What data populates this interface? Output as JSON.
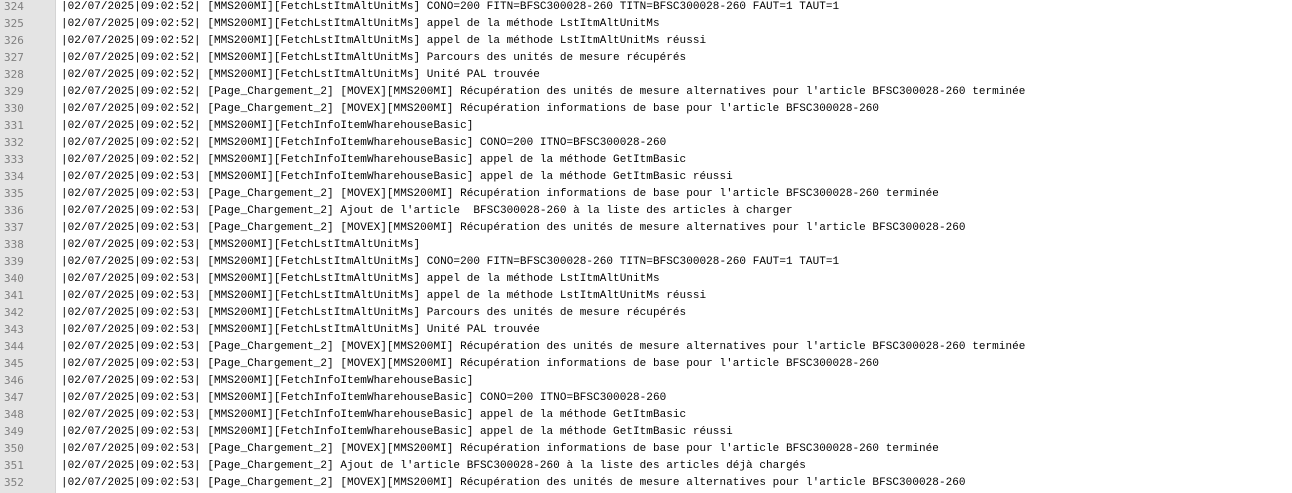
{
  "editor": {
    "lines": [
      {
        "num": "324",
        "text": "|02/07/2025|09:02:52| [MMS200MI][FetchLstItmAltUnitMs] CONO=200 FITN=BFSC300028-260 TITN=BFSC300028-260 FAUT=1 TAUT=1"
      },
      {
        "num": "325",
        "text": "|02/07/2025|09:02:52| [MMS200MI][FetchLstItmAltUnitMs] appel de la méthode LstItmAltUnitMs"
      },
      {
        "num": "326",
        "text": "|02/07/2025|09:02:52| [MMS200MI][FetchLstItmAltUnitMs] appel de la méthode LstItmAltUnitMs réussi"
      },
      {
        "num": "327",
        "text": "|02/07/2025|09:02:52| [MMS200MI][FetchLstItmAltUnitMs] Parcours des unités de mesure récupérés"
      },
      {
        "num": "328",
        "text": "|02/07/2025|09:02:52| [MMS200MI][FetchLstItmAltUnitMs] Unité PAL trouvée"
      },
      {
        "num": "329",
        "text": "|02/07/2025|09:02:52| [Page_Chargement_2] [MOVEX][MMS200MI] Récupération des unités de mesure alternatives pour l'article BFSC300028-260 terminée"
      },
      {
        "num": "330",
        "text": "|02/07/2025|09:02:52| [Page_Chargement_2] [MOVEX][MMS200MI] Récupération informations de base pour l'article BFSC300028-260"
      },
      {
        "num": "331",
        "text": "|02/07/2025|09:02:52| [MMS200MI][FetchInfoItemWharehouseBasic]"
      },
      {
        "num": "332",
        "text": "|02/07/2025|09:02:52| [MMS200MI][FetchInfoItemWharehouseBasic] CONO=200 ITNO=BFSC300028-260"
      },
      {
        "num": "333",
        "text": "|02/07/2025|09:02:52| [MMS200MI][FetchInfoItemWharehouseBasic] appel de la méthode GetItmBasic"
      },
      {
        "num": "334",
        "text": "|02/07/2025|09:02:53| [MMS200MI][FetchInfoItemWharehouseBasic] appel de la méthode GetItmBasic réussi"
      },
      {
        "num": "335",
        "text": "|02/07/2025|09:02:53| [Page_Chargement_2] [MOVEX][MMS200MI] Récupération informations de base pour l'article BFSC300028-260 terminée"
      },
      {
        "num": "336",
        "text": "|02/07/2025|09:02:53| [Page_Chargement_2] Ajout de l'article  BFSC300028-260 à la liste des articles à charger"
      },
      {
        "num": "337",
        "text": "|02/07/2025|09:02:53| [Page_Chargement_2] [MOVEX][MMS200MI] Récupération des unités de mesure alternatives pour l'article BFSC300028-260"
      },
      {
        "num": "338",
        "text": "|02/07/2025|09:02:53| [MMS200MI][FetchLstItmAltUnitMs]"
      },
      {
        "num": "339",
        "text": "|02/07/2025|09:02:53| [MMS200MI][FetchLstItmAltUnitMs] CONO=200 FITN=BFSC300028-260 TITN=BFSC300028-260 FAUT=1 TAUT=1"
      },
      {
        "num": "340",
        "text": "|02/07/2025|09:02:53| [MMS200MI][FetchLstItmAltUnitMs] appel de la méthode LstItmAltUnitMs"
      },
      {
        "num": "341",
        "text": "|02/07/2025|09:02:53| [MMS200MI][FetchLstItmAltUnitMs] appel de la méthode LstItmAltUnitMs réussi"
      },
      {
        "num": "342",
        "text": "|02/07/2025|09:02:53| [MMS200MI][FetchLstItmAltUnitMs] Parcours des unités de mesure récupérés"
      },
      {
        "num": "343",
        "text": "|02/07/2025|09:02:53| [MMS200MI][FetchLstItmAltUnitMs] Unité PAL trouvée"
      },
      {
        "num": "344",
        "text": "|02/07/2025|09:02:53| [Page_Chargement_2] [MOVEX][MMS200MI] Récupération des unités de mesure alternatives pour l'article BFSC300028-260 terminée"
      },
      {
        "num": "345",
        "text": "|02/07/2025|09:02:53| [Page_Chargement_2] [MOVEX][MMS200MI] Récupération informations de base pour l'article BFSC300028-260"
      },
      {
        "num": "346",
        "text": "|02/07/2025|09:02:53| [MMS200MI][FetchInfoItemWharehouseBasic]"
      },
      {
        "num": "347",
        "text": "|02/07/2025|09:02:53| [MMS200MI][FetchInfoItemWharehouseBasic] CONO=200 ITNO=BFSC300028-260"
      },
      {
        "num": "348",
        "text": "|02/07/2025|09:02:53| [MMS200MI][FetchInfoItemWharehouseBasic] appel de la méthode GetItmBasic"
      },
      {
        "num": "349",
        "text": "|02/07/2025|09:02:53| [MMS200MI][FetchInfoItemWharehouseBasic] appel de la méthode GetItmBasic réussi"
      },
      {
        "num": "350",
        "text": "|02/07/2025|09:02:53| [Page_Chargement_2] [MOVEX][MMS200MI] Récupération informations de base pour l'article BFSC300028-260 terminée"
      },
      {
        "num": "351",
        "text": "|02/07/2025|09:02:53| [Page_Chargement_2] Ajout de l'article BFSC300028-260 à la liste des articles déjà chargés"
      },
      {
        "num": "352",
        "text": "|02/07/2025|09:02:53| [Page_Chargement_2] [MOVEX][MMS200MI] Récupération des unités de mesure alternatives pour l'article BFSC300028-260"
      }
    ]
  }
}
